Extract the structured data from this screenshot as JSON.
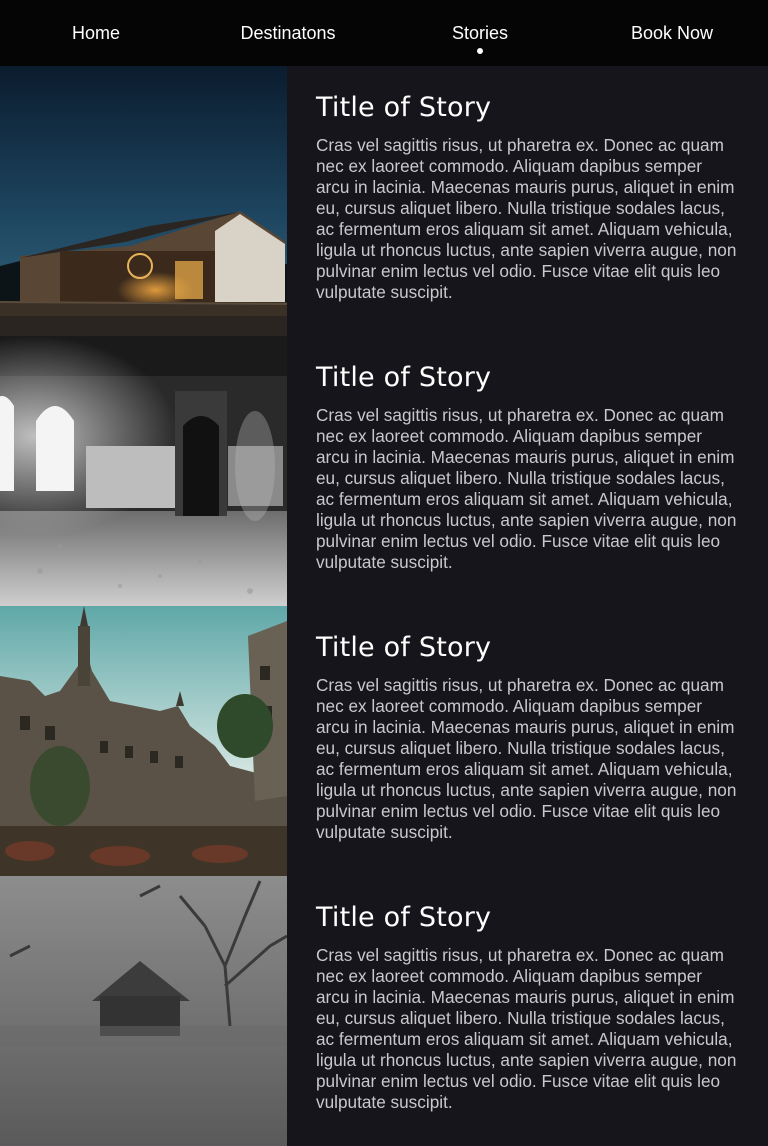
{
  "nav": {
    "items": [
      {
        "label": "Home"
      },
      {
        "label": "Destinatons"
      },
      {
        "label": "Stories"
      },
      {
        "label": "Book Now"
      }
    ],
    "active_index": 2
  },
  "stories": [
    {
      "title": "Title of Story",
      "text": "Cras vel sagittis risus, ut pharetra ex. Donec ac quam nec ex laoreet commodo. Aliquam dapibus semper arcu in lacinia. Maecenas mauris purus, aliquet in enim eu, cursus aliquet libero. Nulla tristique sodales lacus, ac fermentum eros aliquam sit amet. Aliquam vehicula, ligula ut rhoncus luctus, ante sapien viverra augue, non pulvinar enim lectus vel odio. Fusce vitae elit quis leo vulputate suscipit.",
      "image": "barn-at-night-photo"
    },
    {
      "title": "Title of Story",
      "text": "Cras vel sagittis risus, ut pharetra ex. Donec ac quam nec ex laoreet commodo. Aliquam dapibus semper arcu in lacinia. Maecenas mauris purus, aliquet in enim eu, cursus aliquet libero. Nulla tristique sodales lacus, ac fermentum eros aliquam sit amet. Aliquam vehicula, ligula ut rhoncus luctus, ante sapien viverra augue, non pulvinar enim lectus vel odio. Fusce vitae elit quis leo vulputate suscipit.",
      "image": "abandoned-hall-ghost-photo"
    },
    {
      "title": "Title of Story",
      "text": "Cras vel sagittis risus, ut pharetra ex. Donec ac quam nec ex laoreet commodo. Aliquam dapibus semper arcu in lacinia. Maecenas mauris purus, aliquet in enim eu, cursus aliquet libero. Nulla tristique sodales lacus, ac fermentum eros aliquam sit amet. Aliquam vehicula, ligula ut rhoncus luctus, ante sapien viverra augue, non pulvinar enim lectus vel odio. Fusce vitae elit quis leo vulputate suscipit.",
      "image": "castle-on-hill-photo"
    },
    {
      "title": "Title of Story",
      "text": "Cras vel sagittis risus, ut pharetra ex. Donec ac quam nec ex laoreet commodo. Aliquam dapibus semper arcu in lacinia. Maecenas mauris purus, aliquet in enim eu, cursus aliquet libero. Nulla tristique sodales lacus, ac fermentum eros aliquam sit amet. Aliquam vehicula, ligula ut rhoncus luctus, ante sapien viverra augue, non pulvinar enim lectus vel odio. Fusce vitae elit quis leo vulputate suscipit.",
      "image": "foggy-house-tree-photo"
    }
  ],
  "colors": {
    "nav_bg": "#050505",
    "page_bg": "#16151b",
    "title": "#ffffff",
    "body_text": "#c9c9cc"
  }
}
